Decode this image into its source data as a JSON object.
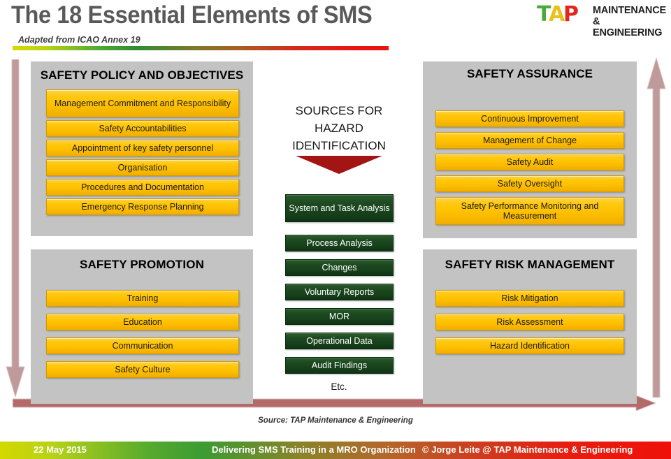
{
  "header": {
    "title": "The 18 Essential Elements of SMS",
    "subtitle": "Adapted from ICAO Annex 19",
    "logo": {
      "letters": [
        "T",
        "A",
        "P"
      ],
      "line1": "MAINTENANCE",
      "line2": "& ENGINEERING"
    }
  },
  "panels": {
    "policy": {
      "title": "SAFETY POLICY AND OBJECTIVES",
      "items": [
        "Management Commitment and Responsibility",
        "Safety Accountabilities",
        "Appointment of key safety personnel",
        "Organisation",
        "Procedures and Documentation",
        "Emergency Response Planning"
      ]
    },
    "promotion": {
      "title": "SAFETY PROMOTION",
      "items": [
        "Training",
        "Education",
        "Communication",
        "Safety Culture"
      ]
    },
    "assurance": {
      "title": "SAFETY ASSURANCE",
      "items": [
        "Continuous Improvement",
        "Management of Change",
        "Safety Audit",
        "Safety Oversight",
        "Safety Performance Monitoring and Measurement"
      ]
    },
    "risk_management": {
      "title": "SAFETY RISK MANAGEMENT",
      "items": [
        "Risk Mitigation",
        "Risk Assessment",
        "Hazard Identification"
      ]
    }
  },
  "center": {
    "heading_line1": "SOURCES FOR",
    "heading_line2": "HAZARD",
    "heading_line3": "IDENTIFICATION",
    "items": [
      "System and Task Analysis",
      "Process Analysis",
      "Changes",
      "Voluntary Reports",
      "MOR",
      "Operational Data",
      "Audit Findings"
    ],
    "etc": "Etc."
  },
  "source_note": "Source: TAP Maintenance & Engineering",
  "footer": {
    "date": "22 May 2015",
    "center": "Delivering SMS Training in a MRO Organization",
    "right": "© Jorge Leite @ TAP Maintenance & Engineering"
  },
  "colors": {
    "panel_gray": "#c3c3c3",
    "box_yellow": "#ffc000",
    "box_green": "#1b4620",
    "arrow_mauve": "#c09a9a",
    "title_gray": "#595959",
    "center_arrow_red": "#a31515"
  }
}
